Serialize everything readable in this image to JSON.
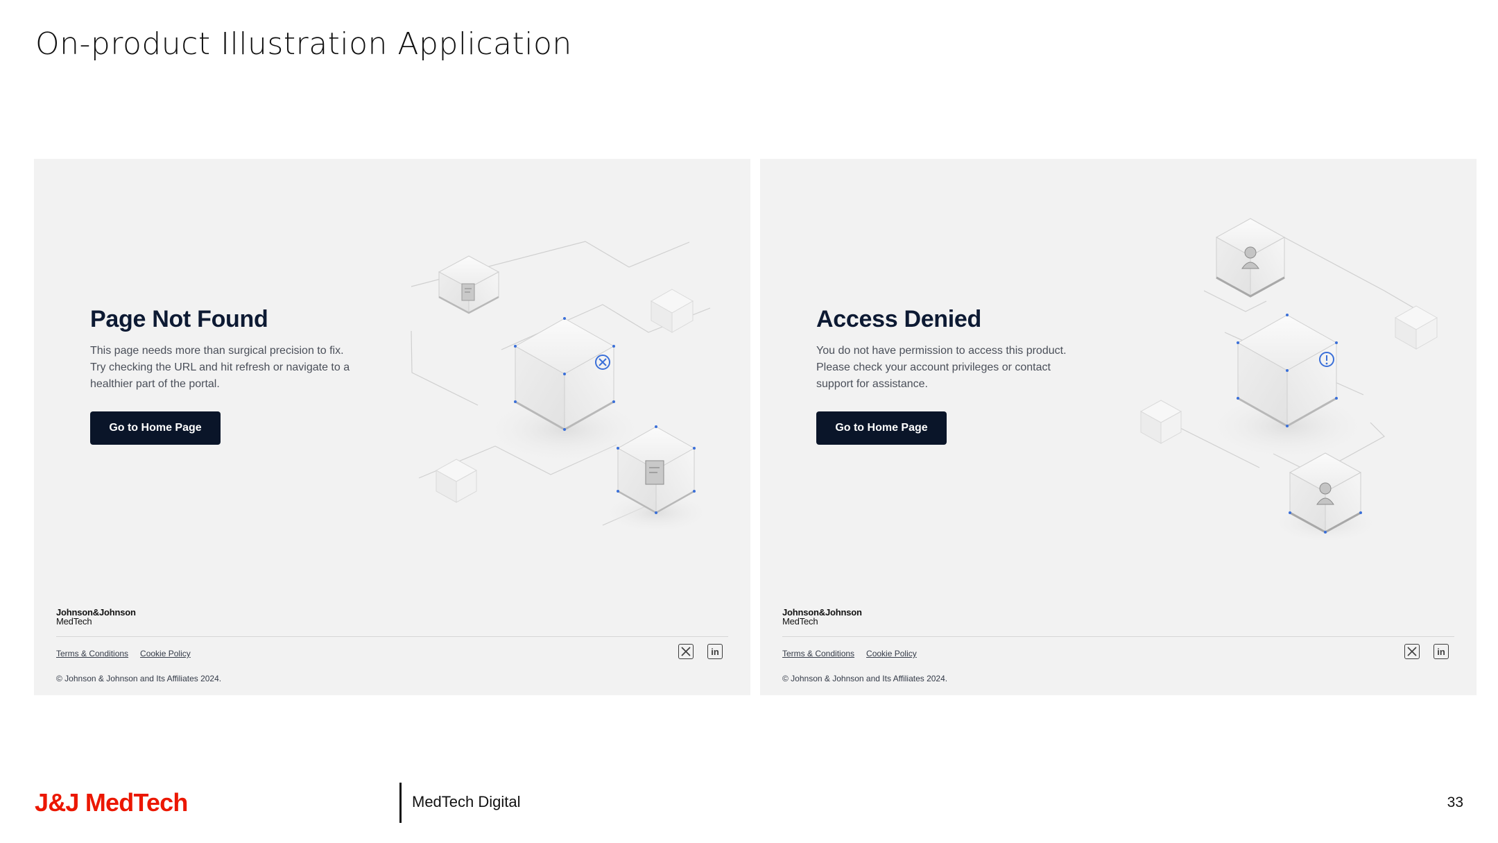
{
  "slide": {
    "title": "On-product Illustration Application"
  },
  "panels": [
    {
      "heading": "Page Not Found",
      "body_lines": [
        "This page needs more than surgical precision to fix.",
        "Try checking the URL and hit refresh or navigate to a",
        "healthier part of the portal."
      ],
      "cta_label": "Go to Home Page",
      "brand": {
        "line1": "Johnson&Johnson",
        "line2": "MedTech"
      },
      "links": [
        "Terms & Conditions",
        "Cookie Policy"
      ],
      "social": {
        "x_icon": "x-icon",
        "linkedin_icon": "linkedin-icon",
        "linkedin_text": "in"
      },
      "copyright": "© Johnson & Johnson and Its Affiliates 2024.",
      "illustration_icon": "close-circle-icon"
    },
    {
      "heading": "Access Denied",
      "body_lines": [
        "You do not have permission to access this product.",
        "Please check your account privileges or contact",
        "support for assistance."
      ],
      "cta_label": "Go to Home Page",
      "brand": {
        "line1": "Johnson&Johnson",
        "line2": "MedTech"
      },
      "links": [
        "Terms & Conditions",
        "Cookie Policy"
      ],
      "social": {
        "x_icon": "x-icon",
        "linkedin_icon": "linkedin-icon",
        "linkedin_text": "in"
      },
      "copyright": "© Johnson & Johnson and Its Affiliates 2024.",
      "illustration_icon": "alert-circle-icon"
    }
  ],
  "footer": {
    "logo_text": "J&J MedTech",
    "subtitle": "MedTech Digital",
    "page_number": "33"
  },
  "colors": {
    "brand_red": "#eb1700",
    "cta_navy": "#0a1529",
    "panel_bg": "#f2f2f2",
    "accent_blue": "#3a6fd8"
  }
}
